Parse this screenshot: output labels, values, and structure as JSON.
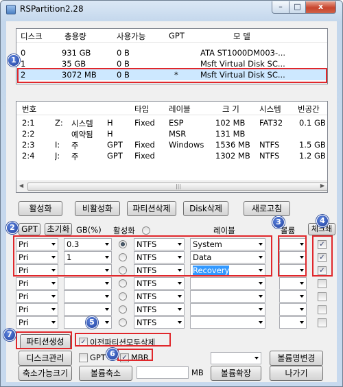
{
  "window": {
    "title": "RSPartition2.28",
    "min_glyph": "–",
    "max_glyph": "□",
    "close_glyph": "x"
  },
  "disk_list": {
    "headers": [
      "디스크",
      "총용량",
      "사용가능",
      "GPT",
      "모 델"
    ],
    "rows": [
      [
        "0",
        "931 GB",
        "0 B",
        "",
        "ATA ST1000DM003-..."
      ],
      [
        "1",
        "35 GB",
        "0 B",
        "",
        "Msft Virtual Disk SC..."
      ],
      [
        "2",
        "3072 MB",
        "0 B",
        "*",
        "Msft Virtual Disk SC..."
      ]
    ]
  },
  "partition_list": {
    "headers": [
      "번호",
      "",
      "",
      "타입",
      "레이블",
      "크 기",
      "시스템",
      "빈공간"
    ],
    "rows": [
      [
        "2:1",
        "Z:",
        "시스템",
        "H",
        "Fixed",
        "ESP",
        "102 MB",
        "FAT32",
        "0.1 GB"
      ],
      [
        "2:2",
        "",
        "예약됨",
        "H",
        "",
        "MSR",
        "131 MB",
        "",
        ""
      ],
      [
        "2:3",
        "I:",
        "주",
        "GPT",
        "Fixed",
        "Windows",
        "1536 MB",
        "NTFS",
        "1.5 GB"
      ],
      [
        "2:4",
        "J:",
        "주",
        "GPT",
        "Fixed",
        "",
        "1302 MB",
        "NTFS",
        "1.2 GB"
      ]
    ],
    "scroll_left": "◀",
    "scroll_right": "▶",
    "scroll_grip": "|||"
  },
  "action_buttons": {
    "activate": "활성화",
    "deactivate": "비활성화",
    "delete_partition": "파티션삭제",
    "delete_disk": "Disk삭제",
    "refresh": "새로고침"
  },
  "grid": {
    "gpt_button": "GPT",
    "init_button": "초기화",
    "col_gb": "GB(%)",
    "col_active": "활성화",
    "col_label": "레이블",
    "col_volume": "볼륨",
    "check_all_button": "체크쇄",
    "rows": [
      {
        "type": "Pri",
        "size": "0.3",
        "active": true,
        "fs": "NTFS",
        "label": "System",
        "volume": "",
        "checked": true
      },
      {
        "type": "Pri",
        "size": "1",
        "active": false,
        "fs": "NTFS",
        "label": "Data",
        "volume": "",
        "checked": true
      },
      {
        "type": "Pri",
        "size": "",
        "active": false,
        "fs": "NTFS",
        "label": "Recovery",
        "volume": "",
        "checked": true
      },
      {
        "type": "Pri",
        "size": "",
        "active": false,
        "fs": "NTFS",
        "label": "",
        "volume": "",
        "checked": false
      },
      {
        "type": "Pri",
        "size": "",
        "active": false,
        "fs": "NTFS",
        "label": "",
        "volume": "",
        "checked": false
      },
      {
        "type": "Pri",
        "size": "",
        "active": false,
        "fs": "NTFS",
        "label": "",
        "volume": "",
        "checked": false
      },
      {
        "type": "Pri",
        "size": "",
        "active": false,
        "fs": "NTFS",
        "label": "",
        "volume": "",
        "checked": false
      }
    ]
  },
  "bottom": {
    "create_partition": "파티션생성",
    "delete_prev_label": "이전파티션모두삭제",
    "delete_prev_checked": true,
    "disk_manage": "디스크관리",
    "gpt_label": "GPT",
    "gpt_checked": false,
    "mbr_label": "MBR",
    "mbr_checked": true,
    "rename_volume": "볼륨명변경",
    "shrink_capacity": "축소가능크기",
    "shrink_volume": "볼륨축소",
    "mb_label": "MB",
    "extend_volume": "볼륨확장",
    "exit": "나가기"
  },
  "callouts": [
    "1",
    "2",
    "3",
    "4",
    "5",
    "6",
    "7"
  ],
  "colors": {
    "callout_border": "#e0272b",
    "callout_badge": "#2a4aa8",
    "selection": "#cde8ff"
  }
}
